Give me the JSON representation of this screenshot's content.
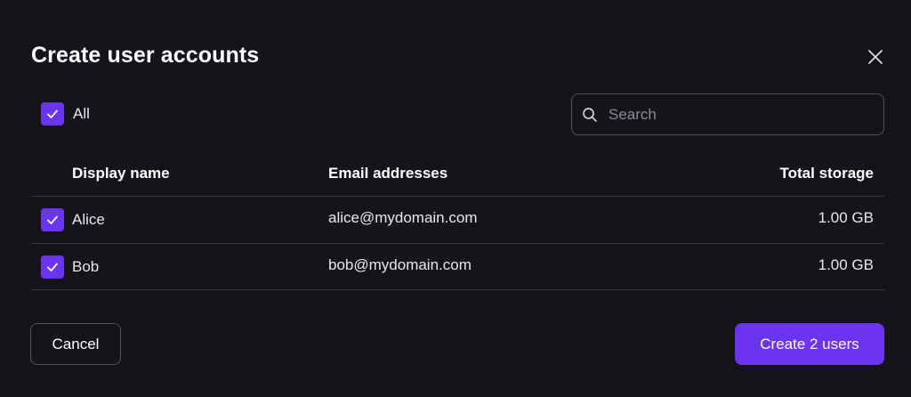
{
  "dialog": {
    "title": "Create user accounts",
    "close_icon": "close-icon"
  },
  "select_all": {
    "label": "All",
    "checked": true,
    "icon": "checkmark-icon"
  },
  "search": {
    "placeholder": "Search",
    "value": "",
    "icon": "search-icon"
  },
  "table": {
    "columns": [
      "Display name",
      "Email addresses",
      "Total storage"
    ],
    "rows": [
      {
        "checked": true,
        "name": "Alice",
        "email": "alice@mydomain.com",
        "storage": "1.00 GB"
      },
      {
        "checked": true,
        "name": "Bob",
        "email": "bob@mydomain.com",
        "storage": "1.00 GB"
      }
    ]
  },
  "actions": {
    "cancel_label": "Cancel",
    "create_label": "Create 2 users"
  },
  "colors": {
    "background": "#16141b",
    "accent": "#6b35f0",
    "border": "#55525e",
    "divider": "#3a3742"
  }
}
